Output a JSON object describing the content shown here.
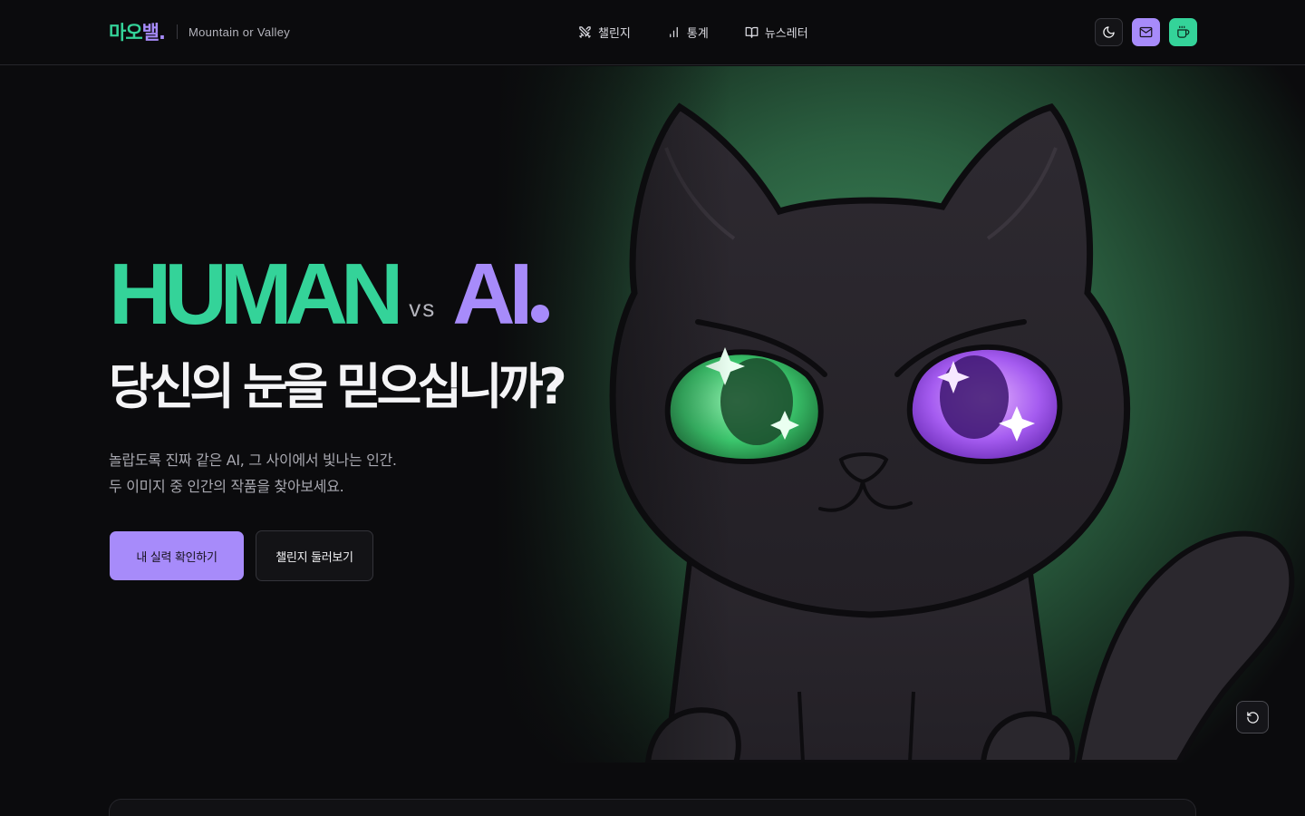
{
  "header": {
    "logo": {
      "part1": "마",
      "part2": "오",
      "part3": "밸",
      "dot": "."
    },
    "tagline": "Mountain or Valley",
    "nav": [
      {
        "label": "챌린지",
        "icon": "swords-icon"
      },
      {
        "label": "통계",
        "icon": "bar-chart-icon"
      },
      {
        "label": "뉴스레터",
        "icon": "book-open-icon"
      }
    ],
    "actions": [
      {
        "icon": "moon-icon",
        "label": "theme toggle"
      },
      {
        "icon": "mail-icon",
        "label": "newsletter"
      },
      {
        "icon": "coffee-icon",
        "label": "buy me a coffee"
      }
    ]
  },
  "hero": {
    "headline_human": "HUMAN",
    "headline_vs": "vs",
    "headline_ai": "AI",
    "subhead": "당신의 눈을 믿으십니까?",
    "desc_line1": "놀랍도록 진짜 같은 AI, 그 사이에서 빛나는 인간.",
    "desc_line2": "두 이미지 중 인간의 작품을 찾아보세요.",
    "cta_primary": "내 실력 확인하기",
    "cta_secondary": "챌린지 둘러보기"
  },
  "colors": {
    "background": "#0b0b0d",
    "accent_green": "#34d399",
    "accent_purple": "#a78bfa"
  }
}
